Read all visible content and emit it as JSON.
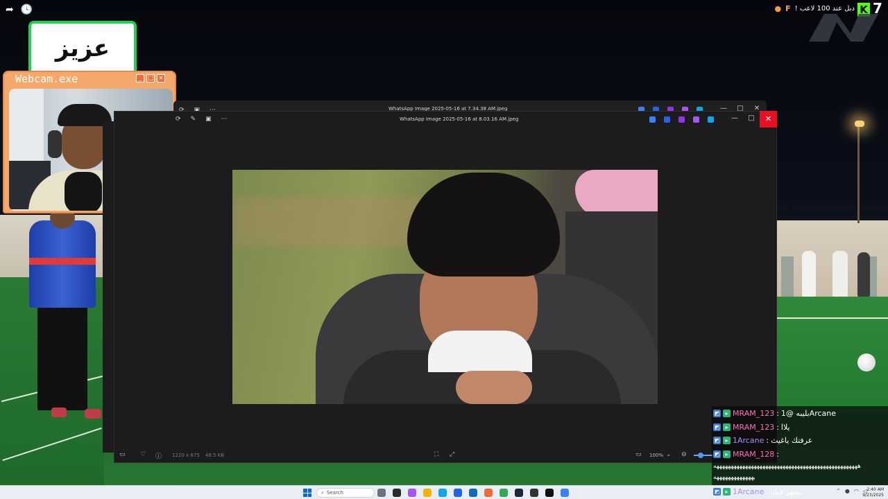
{
  "overlay": {
    "name_banner": "عزيز",
    "ticker_text": "! دبل عند 100 لاعب",
    "ticker_f": "F",
    "kick_badge": "K",
    "kick_count": "7"
  },
  "webcam": {
    "title": "Webcam.exe",
    "buttons": [
      "_",
      "□",
      "×"
    ]
  },
  "viewer_back": {
    "title": "WhatsApp Image 2025-05-16 at 7.34.38 AM.jpeg",
    "controls": [
      "—",
      "□",
      "✕"
    ]
  },
  "viewer_front": {
    "title": "WhatsApp Image 2025-05-16 at 8.03.16 AM.jpeg",
    "controls": [
      "—",
      "□",
      "✕"
    ],
    "toolbar_icons": [
      "rotate-icon",
      "edit-icon",
      "slideshow-icon",
      "more-icon"
    ],
    "more_label": "···",
    "bottom": {
      "dimensions": "1220 x 675",
      "filesize": "48.5 KB",
      "zoom": "100%"
    }
  },
  "chat": {
    "messages": [
      {
        "user": "MRAM_123",
        "text": "بليبه @1Arcane"
      },
      {
        "user": "MRAM_123",
        "text": "يلاا"
      },
      {
        "user": "1Arcane",
        "text": "عرفتك ياغيث"
      },
      {
        "user": "MRAM_128",
        "text": ""
      }
    ],
    "spam": "ههههههههههههههههههههههههههههههههههههههههههههههههههه",
    "last": {
      "user": "1Arcane",
      "text": "بشهر فيك"
    }
  },
  "taskbar": {
    "search_placeholder": "Search",
    "clock_time": "2:40 AM",
    "clock_date": "9/23/2025"
  },
  "colors": {
    "accent_green": "#1fd34e",
    "webcam_orange": "#f4a96a",
    "close_red": "#e81123",
    "kick_green": "#53fc18"
  }
}
